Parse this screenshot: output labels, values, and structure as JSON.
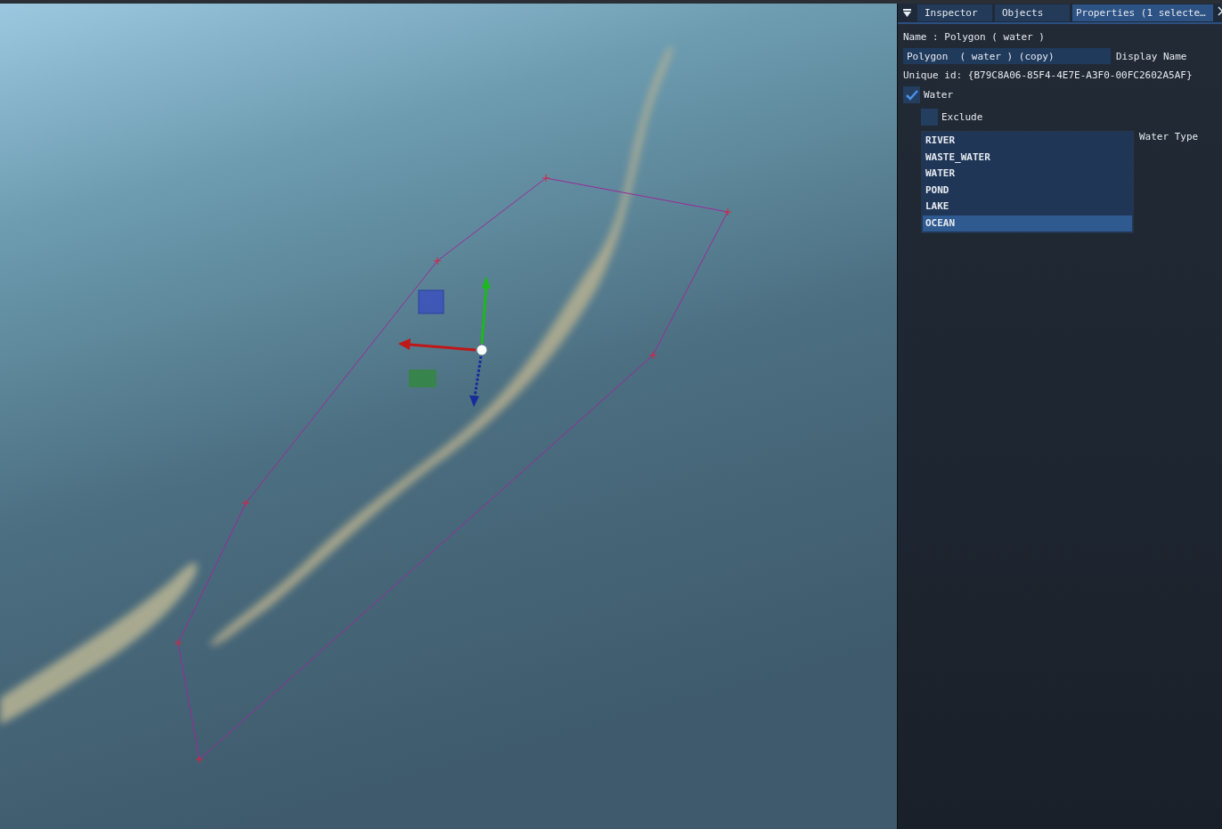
{
  "tabs": [
    {
      "label": "Inspector",
      "selected": false
    },
    {
      "label": "Objects",
      "selected": false
    },
    {
      "label": "Properties (1 selecte…",
      "selected": true
    }
  ],
  "name_line": "Name : Polygon  ( water )",
  "display_name": {
    "value": "Polygon  ( water ) (copy)",
    "label": "Display Name"
  },
  "unique_id": "Unique id: {B79C8A06-85F4-4E7E-A3F0-00FC2602A5AF}",
  "checkboxes": [
    {
      "label": "Water",
      "checked": true,
      "indented": false
    },
    {
      "label": "Exclude",
      "checked": false,
      "indented": true
    }
  ],
  "water_type": {
    "label": "Water Type",
    "options": [
      {
        "label": "RIVER",
        "selected": false
      },
      {
        "label": "WASTE_WATER",
        "selected": false
      },
      {
        "label": "WATER",
        "selected": false
      },
      {
        "label": "POND",
        "selected": false
      },
      {
        "label": "LAKE",
        "selected": false
      },
      {
        "label": "OCEAN",
        "selected": true
      }
    ]
  }
}
